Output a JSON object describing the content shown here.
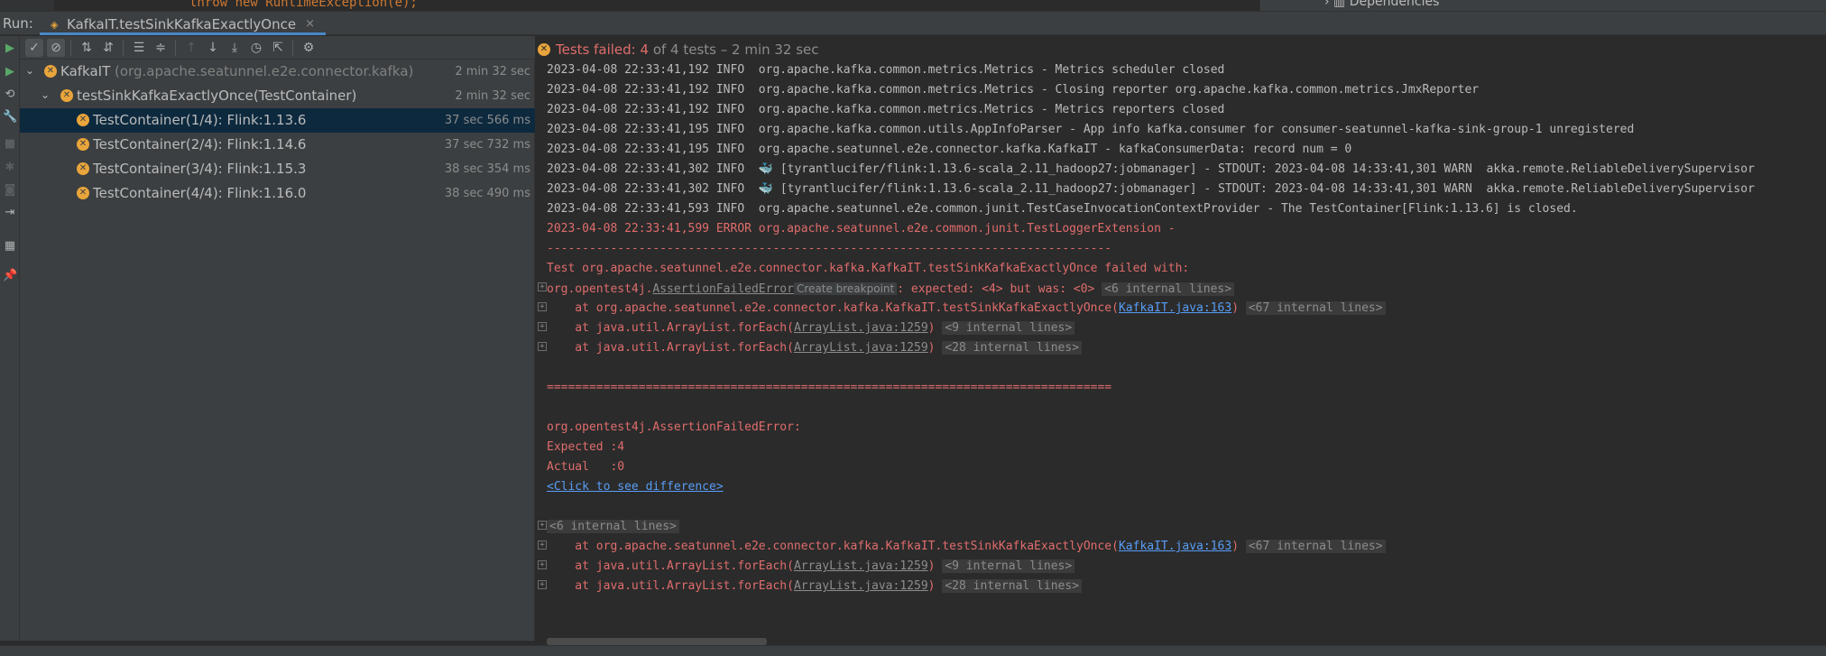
{
  "editor": {
    "code_fragment": "throw new RuntimeException(e);",
    "project_tree_item": "Dependencies"
  },
  "run_window": {
    "label": "Run:",
    "tab_title": "KafkaIT.testSinkKafkaExactlyOnce",
    "close_glyph": "×"
  },
  "tree": {
    "root": {
      "name": "KafkaIT",
      "package": "(org.apache.seatunnel.e2e.connector.kafka)",
      "time": "2 min 32 sec"
    },
    "method": {
      "name": "testSinkKafkaExactlyOnce(TestContainer)",
      "time": "2 min 32 sec"
    },
    "children": [
      {
        "name": "TestContainer(1/4): Flink:1.13.6",
        "time": "37 sec 566 ms"
      },
      {
        "name": "TestContainer(2/4): Flink:1.14.6",
        "time": "37 sec 732 ms"
      },
      {
        "name": "TestContainer(3/4): Flink:1.15.3",
        "time": "38 sec 354 ms"
      },
      {
        "name": "TestContainer(4/4): Flink:1.16.0",
        "time": "38 sec 490 ms"
      }
    ]
  },
  "summary": {
    "failed": "Tests failed: 4",
    "rest": "of 4 tests – 2 min 32 sec"
  },
  "console": {
    "l1": "2023-04-08 22:33:41,192 INFO  org.apache.kafka.common.metrics.Metrics - Metrics scheduler closed",
    "l2": "2023-04-08 22:33:41,192 INFO  org.apache.kafka.common.metrics.Metrics - Closing reporter org.apache.kafka.common.metrics.JmxReporter",
    "l3": "2023-04-08 22:33:41,192 INFO  org.apache.kafka.common.metrics.Metrics - Metrics reporters closed",
    "l4": "2023-04-08 22:33:41,195 INFO  org.apache.kafka.common.utils.AppInfoParser - App info kafka.consumer for consumer-seatunnel-kafka-sink-group-1 unregistered",
    "l5": "2023-04-08 22:33:41,195 INFO  org.apache.seatunnel.e2e.connector.kafka.KafkaIT - kafkaConsumerData: record num = 0",
    "l6a": "2023-04-08 22:33:41,302 INFO  ",
    "l6b": " [tyrantlucifer/flink:1.13.6-scala_2.11_hadoop27:jobmanager] - STDOUT: 2023-04-08 14:33:41,301 WARN  akka.remote.ReliableDeliverySupervisor",
    "l7a": "2023-04-08 22:33:41,302 INFO  ",
    "l7b": " [tyrantlucifer/flink:1.13.6-scala_2.11_hadoop27:jobmanager] - STDOUT: 2023-04-08 14:33:41,301 WARN  akka.remote.ReliableDeliverySupervisor",
    "whale": "🐳",
    "l8": "2023-04-08 22:33:41,593 INFO  org.apache.seatunnel.e2e.common.junit.TestCaseInvocationContextProvider - The TestContainer[Flink:1.13.6] is closed.",
    "l9": "2023-04-08 22:33:41,599 ERROR org.apache.seatunnel.e2e.common.junit.TestLoggerExtension -",
    "dashes": "--------------------------------------------------------------------------------",
    "l11": "Test org.apache.seatunnel.e2e.connector.kafka.KafkaIT.testSinkKafkaExactlyOnce failed with:",
    "l12a": "org.opentest4j.",
    "l12b": "AssertionFailedError",
    "tooltip": "Create breakpoint",
    "l12c": ": expected: <4> but was: <0>",
    "fold6": "<6 internal lines>",
    "at_kafka": "    at org.apache.seatunnel.e2e.connector.kafka.KafkaIT.testSinkKafkaExactlyOnce(",
    "kafka_link": "KafkaIT.java:163",
    "fold67": "<67 internal lines>",
    "at_foreach": "    at java.util.ArrayList.forEach(",
    "arr_link": "ArrayList.java:1259",
    "fold9": "<9 internal lines>",
    "fold28": "<28 internal lines>",
    "close_paren": ")",
    "equals": "================================================================================",
    "l18": "org.opentest4j.AssertionFailedError:",
    "l19": "Expected :4",
    "l20": "Actual   :0",
    "diff_link": "<Click to see difference>"
  }
}
